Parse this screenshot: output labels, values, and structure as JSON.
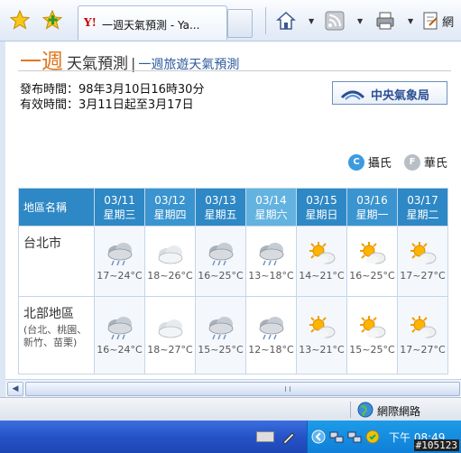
{
  "browser": {
    "tab_title": "一週天氣預測 - Ya...",
    "tab_logo": "Y!",
    "toolbar_right_text": "網"
  },
  "page": {
    "heading_big": "一週",
    "heading_title": "天氣預測",
    "heading_sep": "|",
    "heading_link": "一週旅遊天氣預測",
    "issue_line": "發布時間：98年3月10日16時30分",
    "valid_line": "有效時間：3月11日起至3月17日",
    "agency": "中央氣象局",
    "unit_c_glyph": "C",
    "unit_c": "攝氏",
    "unit_f_glyph": "F",
    "unit_f": "華氏"
  },
  "table": {
    "header_label": "地區名稱",
    "days": [
      {
        "date": "03/11",
        "weekday": "星期三"
      },
      {
        "date": "03/12",
        "weekday": "星期四"
      },
      {
        "date": "03/13",
        "weekday": "星期五"
      },
      {
        "date": "03/14",
        "weekday": "星期六"
      },
      {
        "date": "03/15",
        "weekday": "星期日"
      },
      {
        "date": "03/16",
        "weekday": "星期一"
      },
      {
        "date": "03/17",
        "weekday": "星期二"
      }
    ],
    "rows": [
      {
        "name": "台北市",
        "sub": "",
        "cells": [
          {
            "icon": "rain-cloud-icon",
            "temp": "17~24°C"
          },
          {
            "icon": "cloud-icon",
            "temp": "18~26°C"
          },
          {
            "icon": "rain-cloud-icon",
            "temp": "16~25°C"
          },
          {
            "icon": "rain-cloud-icon",
            "temp": "13~18°C"
          },
          {
            "icon": "sun-cloud-icon",
            "temp": "14~21°C"
          },
          {
            "icon": "sun-cloud-icon",
            "temp": "16~25°C"
          },
          {
            "icon": "sun-cloud-icon",
            "temp": "17~27°C"
          }
        ]
      },
      {
        "name": "北部地區",
        "sub": "(台北、桃園、新竹、苗栗)",
        "cells": [
          {
            "icon": "rain-cloud-icon",
            "temp": "16~24°C"
          },
          {
            "icon": "cloud-icon",
            "temp": "18~27°C"
          },
          {
            "icon": "rain-cloud-icon",
            "temp": "15~25°C"
          },
          {
            "icon": "rain-cloud-icon",
            "temp": "12~18°C"
          },
          {
            "icon": "sun-cloud-icon",
            "temp": "13~21°C"
          },
          {
            "icon": "sun-cloud-icon",
            "temp": "15~25°C"
          },
          {
            "icon": "sun-cloud-icon",
            "temp": "17~27°C"
          }
        ]
      }
    ]
  },
  "status": {
    "zone": "網際網路"
  },
  "taskbar": {
    "clock": "下午 08:49"
  },
  "watermark": "#105123"
}
